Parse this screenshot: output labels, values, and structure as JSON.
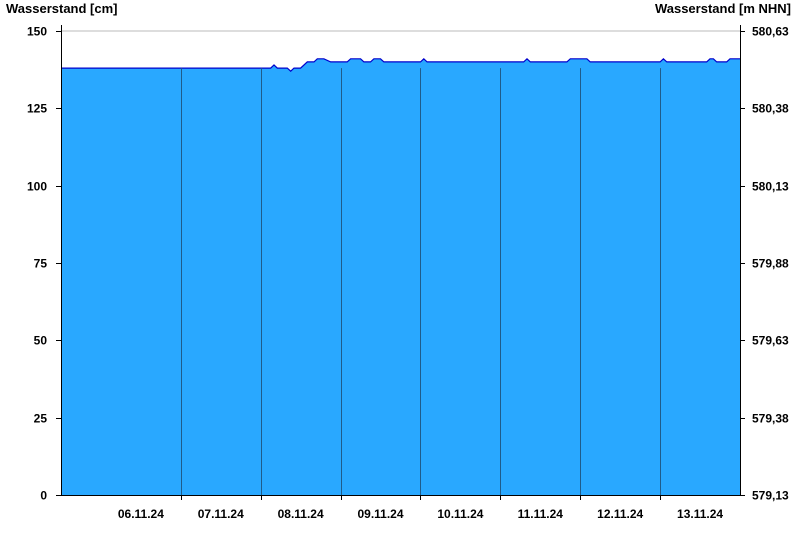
{
  "chart_data": {
    "type": "area",
    "ylabel_left": "Wasserstand [cm]",
    "ylabel_right": "Wasserstand [m NHN]",
    "ylim": [
      0,
      150
    ],
    "yticks_left": [
      {
        "value": 0,
        "label": "0"
      },
      {
        "value": 25,
        "label": "25"
      },
      {
        "value": 50,
        "label": "50"
      },
      {
        "value": 75,
        "label": "75"
      },
      {
        "value": 100,
        "label": "100"
      },
      {
        "value": 125,
        "label": "125"
      },
      {
        "value": 150,
        "label": "150"
      }
    ],
    "yticks_right": [
      {
        "value": 0,
        "label": "579,13"
      },
      {
        "value": 25,
        "label": "579,38"
      },
      {
        "value": 50,
        "label": "579,63"
      },
      {
        "value": 75,
        "label": "579,88"
      },
      {
        "value": 100,
        "label": "580,13"
      },
      {
        "value": 125,
        "label": "580,38"
      },
      {
        "value": 150,
        "label": "580,63"
      }
    ],
    "xlim": [
      "05.11.24 12:00",
      "13.11.24 24:00"
    ],
    "day_labels": [
      "06.11.24",
      "07.11.24",
      "08.11.24",
      "09.11.24",
      "10.11.24",
      "11.11.24",
      "12.11.24",
      "13.11.24"
    ],
    "day_boundaries": [
      "07.11.24 00:00",
      "08.11.24 00:00",
      "09.11.24 00:00",
      "10.11.24 00:00",
      "11.11.24 00:00",
      "12.11.24 00:00",
      "13.11.24 00:00"
    ],
    "fill_color": "#29a8ff",
    "line_color": "#0000cc",
    "grid_color": "#1f5c8a",
    "series": [
      {
        "x": [
          "05.11.24 12:00",
          "06.11.24 12:00",
          "07.11.24 12:00",
          "08.11.24 03:00",
          "08.11.24 04:00",
          "08.11.24 05:00",
          "08.11.24 08:00",
          "08.11.24 09:00",
          "08.11.24 10:00",
          "08.11.24 11:00",
          "08.11.24 12:00",
          "08.11.24 14:00",
          "08.11.24 16:00",
          "08.11.24 17:00",
          "08.11.24 19:00",
          "08.11.24 21:00",
          "08.11.24 22:00",
          "09.11.24 00:00",
          "09.11.24 02:00",
          "09.11.24 03:00",
          "09.11.24 04:00",
          "09.11.24 06:00",
          "09.11.24 07:00",
          "09.11.24 08:00",
          "09.11.24 09:00",
          "09.11.24 10:00",
          "09.11.24 11:00",
          "09.11.24 12:00",
          "09.11.24 13:00",
          "09.11.24 14:00",
          "09.11.24 15:00",
          "09.11.24 16:00",
          "09.11.24 17:00",
          "09.11.24 18:00",
          "10.11.24 00:00",
          "10.11.24 01:00",
          "10.11.24 02:00",
          "11.11.24 00:00",
          "11.11.24 07:00",
          "11.11.24 08:00",
          "11.11.24 09:00",
          "11.11.24 20:00",
          "11.11.24 21:00",
          "12.11.24 02:00",
          "12.11.24 03:00",
          "13.11.24 00:00",
          "13.11.24 01:00",
          "13.11.24 02:00",
          "13.11.24 03:00",
          "13.11.24 14:00",
          "13.11.24 15:00",
          "13.11.24 16:00",
          "13.11.24 17:00",
          "13.11.24 18:00",
          "13.11.24 20:00",
          "13.11.24 21:00",
          "13.11.24 24:00"
        ],
        "y": [
          138,
          138,
          138,
          138,
          139,
          138,
          138,
          137,
          138,
          138,
          138,
          140,
          140,
          141,
          141,
          140,
          140,
          140,
          140,
          141,
          141,
          141,
          140,
          140,
          140,
          141,
          141,
          141,
          140,
          140,
          140,
          140,
          140,
          140,
          140,
          141,
          140,
          140,
          140,
          141,
          140,
          140,
          141,
          141,
          140,
          140,
          141,
          140,
          140,
          140,
          141,
          141,
          140,
          140,
          140,
          141,
          141
        ]
      }
    ]
  }
}
